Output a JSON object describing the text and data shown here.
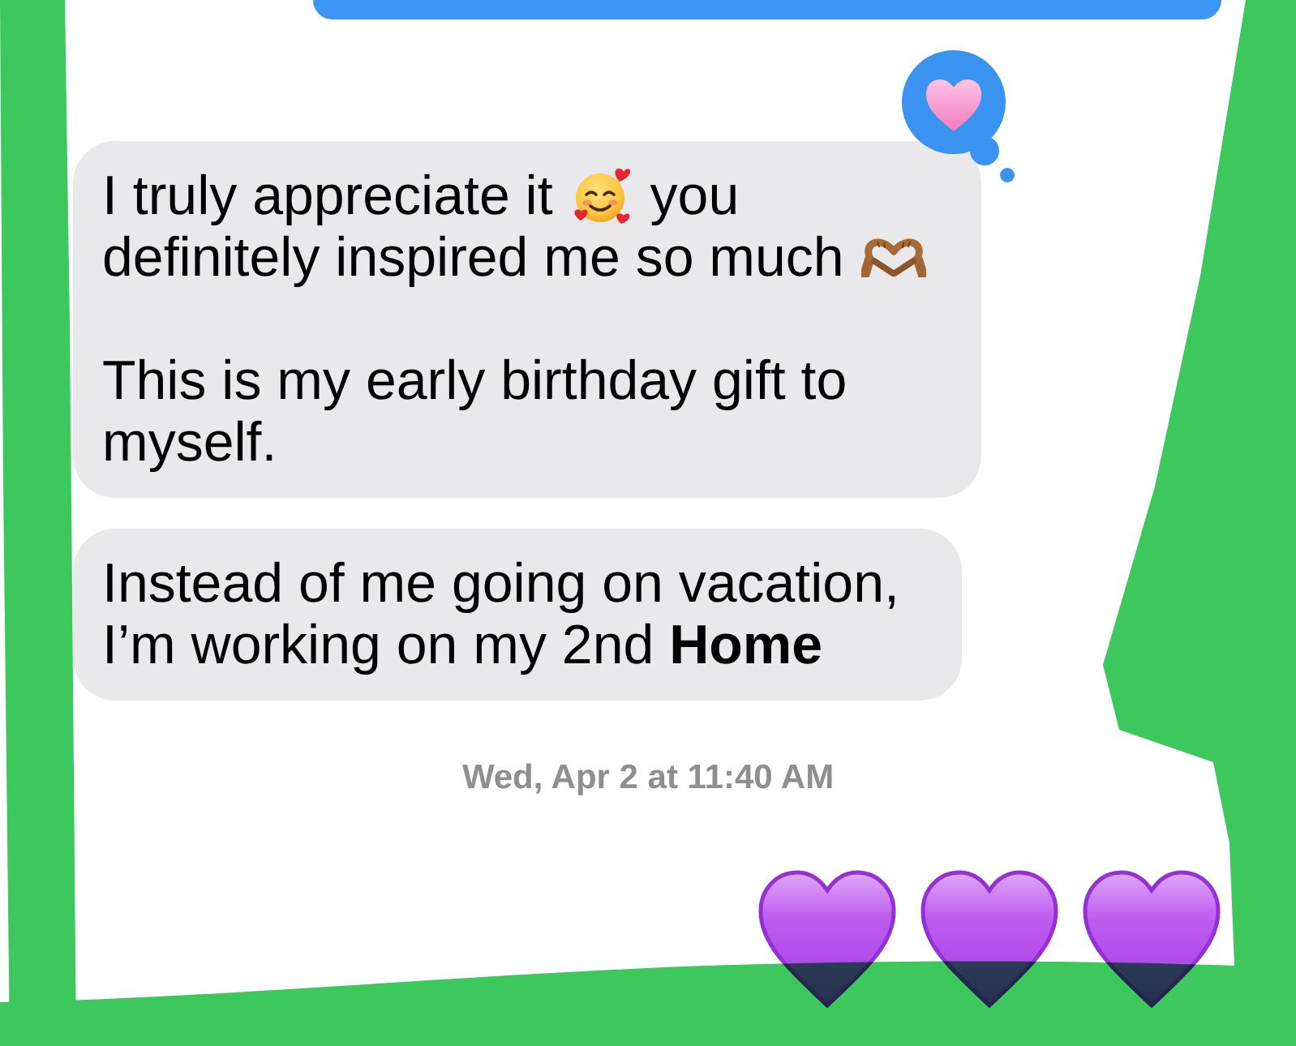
{
  "messages": [
    {
      "paragraphs": [
        {
          "parts": [
            {
              "kind": "text",
              "text": "I truly appreciate it"
            },
            {
              "kind": "smiling_face"
            },
            {
              "kind": "text",
              "text": "you"
            },
            {
              "kind": "text",
              "text": "definitely inspired me so much"
            },
            {
              "kind": "heart_hands"
            }
          ]
        },
        {
          "parts": [
            {
              "kind": "text",
              "text": "This is my early birthday gift to myself."
            }
          ]
        }
      ],
      "reaction": {
        "kind": "heart"
      }
    },
    {
      "paragraphs": [
        {
          "parts": [
            {
              "kind": "text",
              "text": "Instead of me going on vacation, I’m working on my 2nd **Home**"
            }
          ]
        }
      ]
    }
  ],
  "timestamp": "Wed, Apr 2 at 11:40 AM",
  "emoji_message": {
    "emojis": [
      {
        "kind": "purple_heart"
      },
      {
        "kind": "purple_heart"
      },
      {
        "kind": "purple_heart"
      }
    ]
  }
}
